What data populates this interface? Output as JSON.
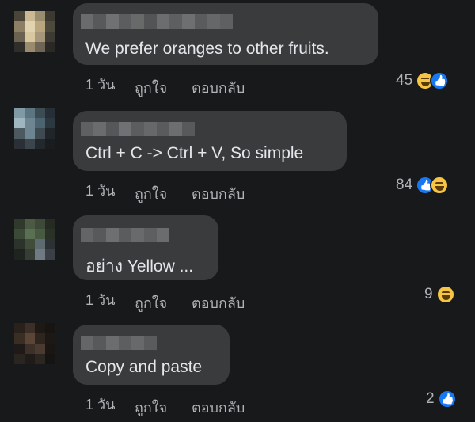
{
  "comments": [
    {
      "text": "We prefer oranges to other fruits.",
      "time": "1 วัน",
      "like": "ถูกใจ",
      "reply": "ตอบกลับ",
      "count": "45",
      "reactions": [
        "haha",
        "like"
      ]
    },
    {
      "text": "Ctrl + C -> Ctrl + V, So simple",
      "time": "1 วัน",
      "like": "ถูกใจ",
      "reply": "ตอบกลับ",
      "count": "84",
      "reactions": [
        "like",
        "haha"
      ]
    },
    {
      "text": "อย่าง Yellow ...",
      "time": "1 วัน",
      "like": "ถูกใจ",
      "reply": "ตอบกลับ",
      "count": "9",
      "reactions": [
        "haha"
      ]
    },
    {
      "text": "Copy and paste",
      "time": "1 วัน",
      "like": "ถูกใจ",
      "reply": "ตอบกลับ",
      "count": "2",
      "reactions": [
        "like"
      ]
    }
  ],
  "colors": {
    "background": "#18191a",
    "bubble": "#3a3b3c",
    "text": "#e4e6eb",
    "meta": "#b0b3b8",
    "like_blue": "#1877f2",
    "haha_yellow": "#f7c544"
  }
}
